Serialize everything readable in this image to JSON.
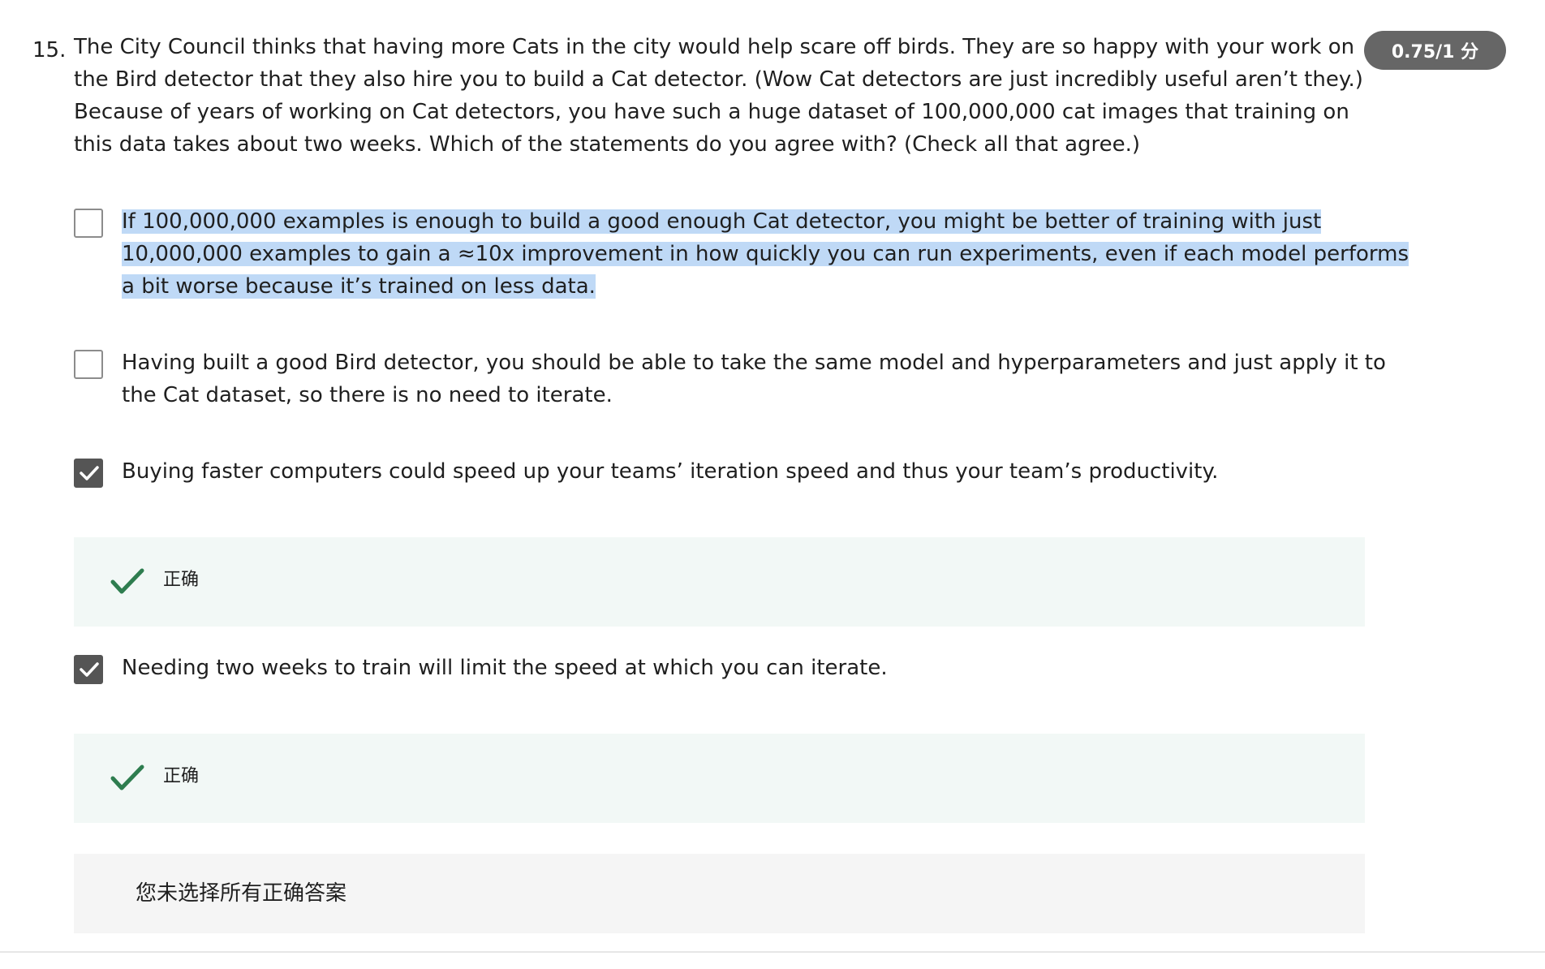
{
  "question": {
    "number": "15.",
    "text": "The City Council thinks that having more Cats in the city would help scare off birds. They are so happy with your work on the Bird detector that they also hire you to build a Cat detector. (Wow Cat detectors are just incredibly useful aren’t they.) Because of years of working on Cat detectors, you have such a huge dataset of 100,000,000 cat images that training on this data takes about two weeks. Which of the statements do you agree with?  (Check all that agree.)",
    "score": "0.75/1 分"
  },
  "options": [
    {
      "label": "If 100,000,000 examples is enough to build a good enough Cat detector, you might be better of training with just 10,000,000 examples to gain a ≈10x improvement in how quickly you can run experiments, even if each model performs a bit worse because it’s trained on less data.",
      "checked": false
    },
    {
      "label": "Having built a good Bird detector, you should be able to take the same model and hyperparameters and just apply it to the Cat dataset, so there is no need to iterate.",
      "checked": false
    },
    {
      "label": "Buying faster computers could speed up your teams’ iteration speed and thus your team’s productivity.",
      "checked": true
    },
    {
      "label": "Needing two weeks to train will limit the speed at which you can iterate.",
      "checked": true
    }
  ],
  "feedback": [
    {
      "text": "正确"
    },
    {
      "text": "正确"
    }
  ],
  "summary": {
    "text": "您未选择所有正确答案"
  },
  "colors": {
    "score_badge": "#666666",
    "checkbox_checked": "#555555",
    "correct_check": "#2e7d4f",
    "feedback_bg": "#f2f8f6",
    "summary_bg": "#f5f5f5",
    "selection_highlight": "#bfd9f6"
  },
  "icons": {
    "correct": "checkmark-icon",
    "checkbox_checked": "checkbox-checked-icon"
  }
}
